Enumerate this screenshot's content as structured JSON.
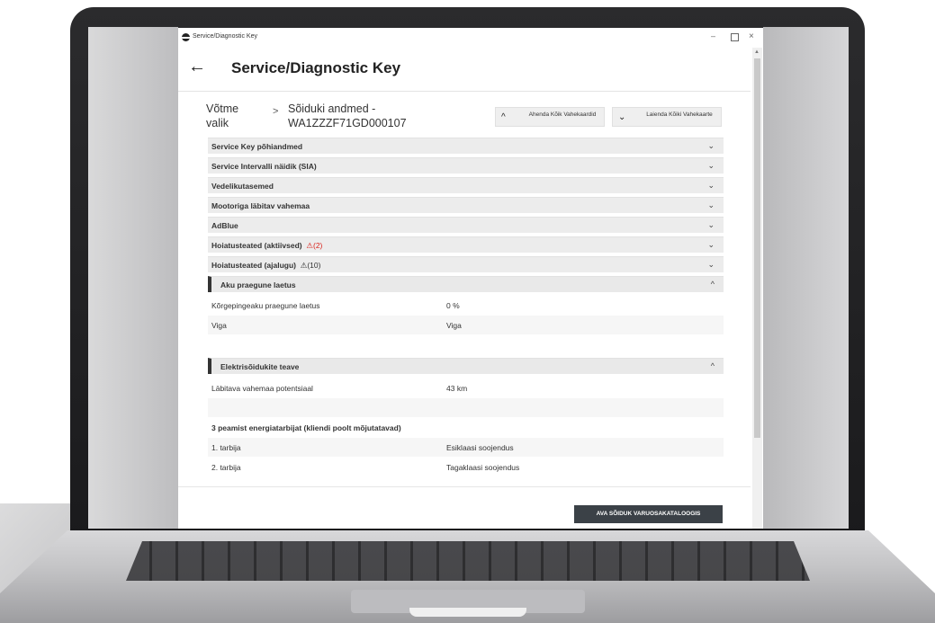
{
  "window": {
    "title": "Service/Diagnostic Key",
    "minimize_glyph": "–",
    "close_glyph": "×"
  },
  "header": {
    "back_glyph": "←",
    "title": "Service/Diagnostic Key"
  },
  "breadcrumb": {
    "step1": "Võtme valik",
    "separator": ">",
    "step2": "Sõiduki andmed - WA1ZZZF71GD000107"
  },
  "toolbar": {
    "collapse_label": "Ahenda Kõik Vahekaardid",
    "collapse_icon": "^",
    "expand_label": "Laienda Kõiki Vahekaarte",
    "expand_icon": "⌄"
  },
  "sections": [
    {
      "label": "Service Key põhiandmed",
      "chevron": "⌄"
    },
    {
      "label": "Service Intervalli näidik (SIA)",
      "chevron": "⌄"
    },
    {
      "label": "Vedelikutasemed",
      "chevron": "⌄"
    },
    {
      "label": "Mootoriga läbitav vahemaa",
      "chevron": "⌄"
    },
    {
      "label": "AdBlue",
      "chevron": "⌄"
    },
    {
      "label": "Hoiatusteated (aktiivsed)",
      "warning_icon": "⚠",
      "count": "(2)",
      "chevron": "⌄"
    },
    {
      "label": "Hoiatusteated (ajalugu)",
      "warning_icon": "⚠",
      "count": "(10)",
      "chevron": "⌄"
    },
    {
      "label": "Aku praegune laetus",
      "chevron": "^"
    },
    {
      "label": "Elektrisõidukite teave",
      "chevron": "^"
    }
  ],
  "battery": [
    {
      "key": "Kõrgepingeaku praegune laetus",
      "value": "0 %"
    },
    {
      "key": "Viga",
      "value": "Viga"
    }
  ],
  "ev": {
    "range_key": "Läbitava vahemaa potentsiaal",
    "range_value": "43 km",
    "consumers_heading": "3 peamist energiatarbijat (kliendi poolt mõjutatavad)",
    "consumers": [
      {
        "key": "1. tarbija",
        "value": "Esiklaasi soojendus"
      },
      {
        "key": "2. tarbija",
        "value": "Tagaklaasi soojendus"
      }
    ]
  },
  "footer": {
    "catalog_button": "AVA SÕIDUK VARUOSAKATALOOGIS"
  },
  "colors": {
    "warning_red": "#d9231d",
    "button_dark": "#3b4147",
    "section_bg": "#ececec"
  }
}
